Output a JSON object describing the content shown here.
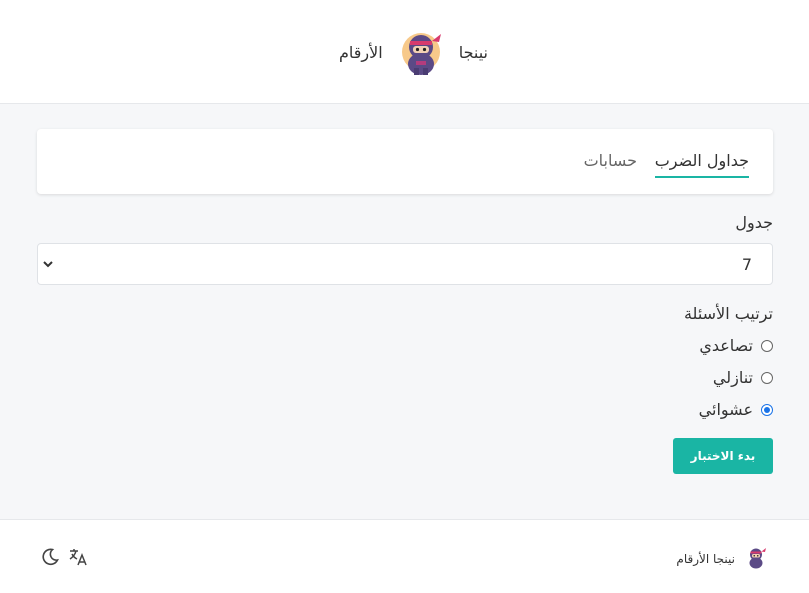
{
  "header": {
    "brand_word_right": "نينجا",
    "brand_word_left": "الأرقام",
    "logo_icon": "ninja-logo"
  },
  "tabs": [
    {
      "label": "جداول الضرب",
      "active": true
    },
    {
      "label": "حسابات",
      "active": false
    }
  ],
  "form": {
    "table_label": "جدول",
    "table_value": "7",
    "order_label": "ترتيب الأسئلة",
    "order_options": [
      {
        "label": "تصاعدي",
        "checked": false
      },
      {
        "label": "تنازلي",
        "checked": false
      },
      {
        "label": "عشوائي",
        "checked": true
      }
    ],
    "start_button": "بدء الاختبار"
  },
  "footer": {
    "brand": "نينجا الأرقام",
    "icons": [
      "moon-icon",
      "translate-icon"
    ]
  },
  "colors": {
    "accent": "#1ab5a4",
    "radio_checked": "#1a73e8",
    "page_bg": "#f6f7f9"
  }
}
